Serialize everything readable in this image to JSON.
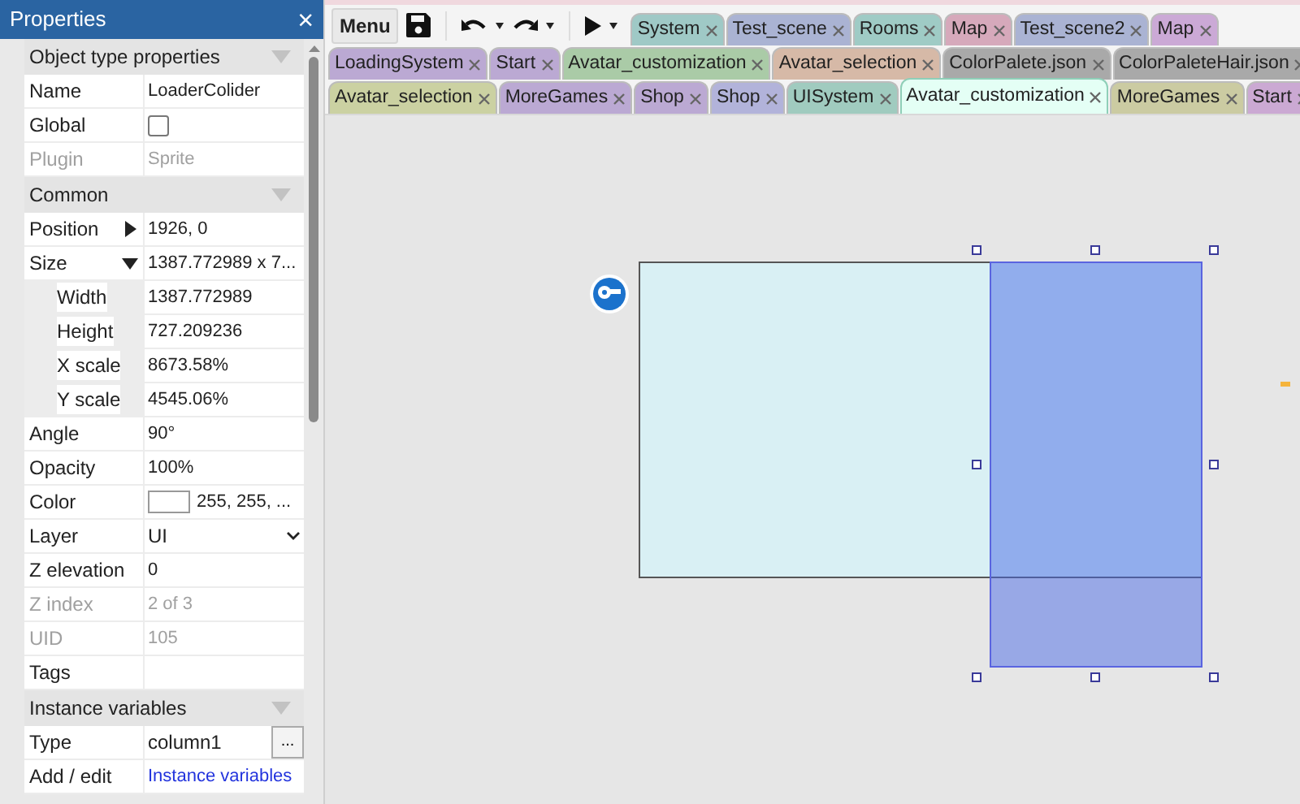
{
  "properties": {
    "title": "Properties",
    "close": "×",
    "sections": [
      {
        "title": "Object type properties",
        "expanded": true,
        "rows": [
          {
            "label": "Name",
            "kind": "text",
            "value": "LoaderColider",
            "disabled": false
          },
          {
            "label": "Global",
            "kind": "checkbox",
            "checked": false,
            "disabled": false
          },
          {
            "label": "Plugin",
            "kind": "text",
            "value": "Sprite",
            "disabled": true
          }
        ]
      },
      {
        "title": "Common",
        "expanded": true,
        "rows": [
          {
            "label": "Position",
            "kind": "text",
            "value": "1926, 0",
            "disabled": false,
            "expanded": false
          },
          {
            "label": "Size",
            "kind": "text",
            "value": "1387.772989 x 7...",
            "disabled": false,
            "expanded": true,
            "children": [
              {
                "label": "Width",
                "kind": "text",
                "value": "1387.772989",
                "disabled": false
              },
              {
                "label": "Height",
                "kind": "text",
                "value": "727.209236",
                "disabled": false
              },
              {
                "label": "X scale",
                "kind": "text",
                "value": "8673.58%",
                "disabled": false
              },
              {
                "label": "Y scale",
                "kind": "text",
                "value": "4545.06%",
                "disabled": false
              }
            ]
          },
          {
            "label": "Angle",
            "kind": "text",
            "value": "90°",
            "disabled": false
          },
          {
            "label": "Opacity",
            "kind": "text",
            "value": "100%",
            "disabled": false
          },
          {
            "label": "Color",
            "kind": "color",
            "color": "#ffffff",
            "value": "255, 255, ...",
            "disabled": false
          },
          {
            "label": "Layer",
            "kind": "dropdown",
            "value": "UI",
            "disabled": false
          },
          {
            "label": "Z elevation",
            "kind": "text",
            "value": "0",
            "disabled": false
          },
          {
            "label": "Z index",
            "kind": "text",
            "value": "2 of 3",
            "disabled": true
          },
          {
            "label": "UID",
            "kind": "text",
            "value": "105",
            "disabled": true
          },
          {
            "label": "Tags",
            "kind": "text",
            "value": "",
            "disabled": false
          }
        ]
      },
      {
        "title": "Instance variables",
        "expanded": true,
        "rows": [
          {
            "label": "Type",
            "kind": "button",
            "value": "column1",
            "button_label": "...",
            "disabled": false
          },
          {
            "label": "Add / edit",
            "kind": "link",
            "value": "Instance variables",
            "disabled": false
          }
        ]
      }
    ]
  },
  "toolbar": {
    "menu": "Menu"
  },
  "tab_rows": [
    [
      {
        "label": "System",
        "color": "#9fc9c6",
        "selected": false
      },
      {
        "label": "Test_scene",
        "color": "#aab3d3",
        "selected": false
      },
      {
        "label": "Rooms",
        "color": "#9fcbc5",
        "selected": false
      },
      {
        "label": "Map",
        "color": "#d6a9bb",
        "selected": false
      },
      {
        "label": "Test_scene2",
        "color": "#aab3d3",
        "selected": false
      },
      {
        "label": "Map",
        "color": "#cba9d6",
        "selected": false
      }
    ],
    [
      {
        "label": "LoadingSystem",
        "color": "#bba9d3",
        "selected": false
      },
      {
        "label": "Start",
        "color": "#bba9d3",
        "selected": false
      },
      {
        "label": "Avatar_customization",
        "color": "#aacba7",
        "selected": false
      },
      {
        "label": "Avatar_selection",
        "color": "#d6b9a7",
        "selected": false
      },
      {
        "label": "ColorPalete.json",
        "color": "#a9a9a9",
        "selected": false
      },
      {
        "label": "ColorPaleteHair.json",
        "color": "#a9a9a9",
        "selected": false
      }
    ],
    [
      {
        "label": "Avatar_selection",
        "color": "#cbd1a2",
        "selected": false
      },
      {
        "label": "MoreGames",
        "color": "#bba9d3",
        "selected": false
      },
      {
        "label": "Shop",
        "color": "#bba9d3",
        "selected": false
      },
      {
        "label": "Shop",
        "color": "#b2b3da",
        "selected": false
      },
      {
        "label": "UISystem",
        "color": "#a0cbbf",
        "selected": false
      },
      {
        "label": "Avatar_customization",
        "color": "#e4fff5",
        "selected": true
      },
      {
        "label": "MoreGames",
        "color": "#cbcba2",
        "selected": false
      },
      {
        "label": "Start",
        "color": "#cba9d3",
        "selected": false
      }
    ]
  ]
}
